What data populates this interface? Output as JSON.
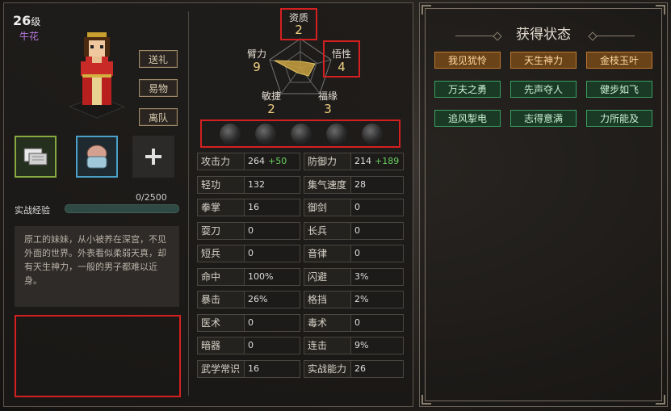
{
  "character": {
    "level": "26",
    "level_unit": "级",
    "name": "牛花"
  },
  "actions": [
    "送礼",
    "易物",
    "离队"
  ],
  "equipment_slots": [
    {
      "icon": "bandage-icon",
      "state": "filled"
    },
    {
      "icon": "bag-icon",
      "state": "filled"
    },
    {
      "icon": "plus-icon",
      "state": "empty"
    }
  ],
  "experience": {
    "label": "实战经验",
    "count": "0/2500",
    "progress": 0
  },
  "bio": "原工的妹妹，从小被养在深宫，不见外面的世界。外表看似柔弱天真，却有天生神力，一般的男子都难以近身。",
  "attributes": [
    {
      "key": "zizhi",
      "label": "资质",
      "value": "2"
    },
    {
      "key": "wuxing",
      "label": "悟性",
      "value": "4"
    },
    {
      "key": "fuyuan",
      "label": "福缘",
      "value": "3"
    },
    {
      "key": "minjie",
      "label": "敏捷",
      "value": "2"
    },
    {
      "key": "liliang",
      "label": "臂力",
      "value": "9"
    }
  ],
  "orbs": 5,
  "stats": [
    {
      "label": "攻击力",
      "value": "264",
      "bonus": "+50"
    },
    {
      "label": "防御力",
      "value": "214",
      "bonus": "+189"
    },
    {
      "label": "轻功",
      "value": "132"
    },
    {
      "label": "集气速度",
      "value": "28"
    },
    {
      "label": "拳掌",
      "value": "16"
    },
    {
      "label": "御剑",
      "value": "0"
    },
    {
      "label": "耍刀",
      "value": "0"
    },
    {
      "label": "长兵",
      "value": "0"
    },
    {
      "label": "短兵",
      "value": "0"
    },
    {
      "label": "音律",
      "value": "0"
    },
    {
      "label": "命中",
      "value": "100%"
    },
    {
      "label": "闪避",
      "value": "3%"
    },
    {
      "label": "暴击",
      "value": "26%"
    },
    {
      "label": "格挡",
      "value": "2%"
    },
    {
      "label": "医术",
      "value": "0"
    },
    {
      "label": "毒术",
      "value": "0"
    },
    {
      "label": "暗器",
      "value": "0"
    },
    {
      "label": "连击",
      "value": "9%"
    },
    {
      "label": "武学常识",
      "value": "16"
    },
    {
      "label": "实战能力",
      "value": "26"
    }
  ],
  "status_panel": {
    "title": "获得状态",
    "tags": [
      {
        "label": "我见犹怜",
        "color": "orange"
      },
      {
        "label": "天生神力",
        "color": "orange"
      },
      {
        "label": "金枝玉叶",
        "color": "orange"
      },
      {
        "label": "万夫之勇",
        "color": "green"
      },
      {
        "label": "先声夺人",
        "color": "green"
      },
      {
        "label": "健步如飞",
        "color": "green"
      },
      {
        "label": "追风掣电",
        "color": "green"
      },
      {
        "label": "志得意满",
        "color": "green"
      },
      {
        "label": "力所能及",
        "color": "green"
      }
    ]
  },
  "colors": {
    "highlight_red": "#d42020",
    "attr_value": "#f0d080",
    "bonus_green": "#6ad060",
    "name_purple": "#b87ae0",
    "radar_fill": "#c8a040"
  }
}
